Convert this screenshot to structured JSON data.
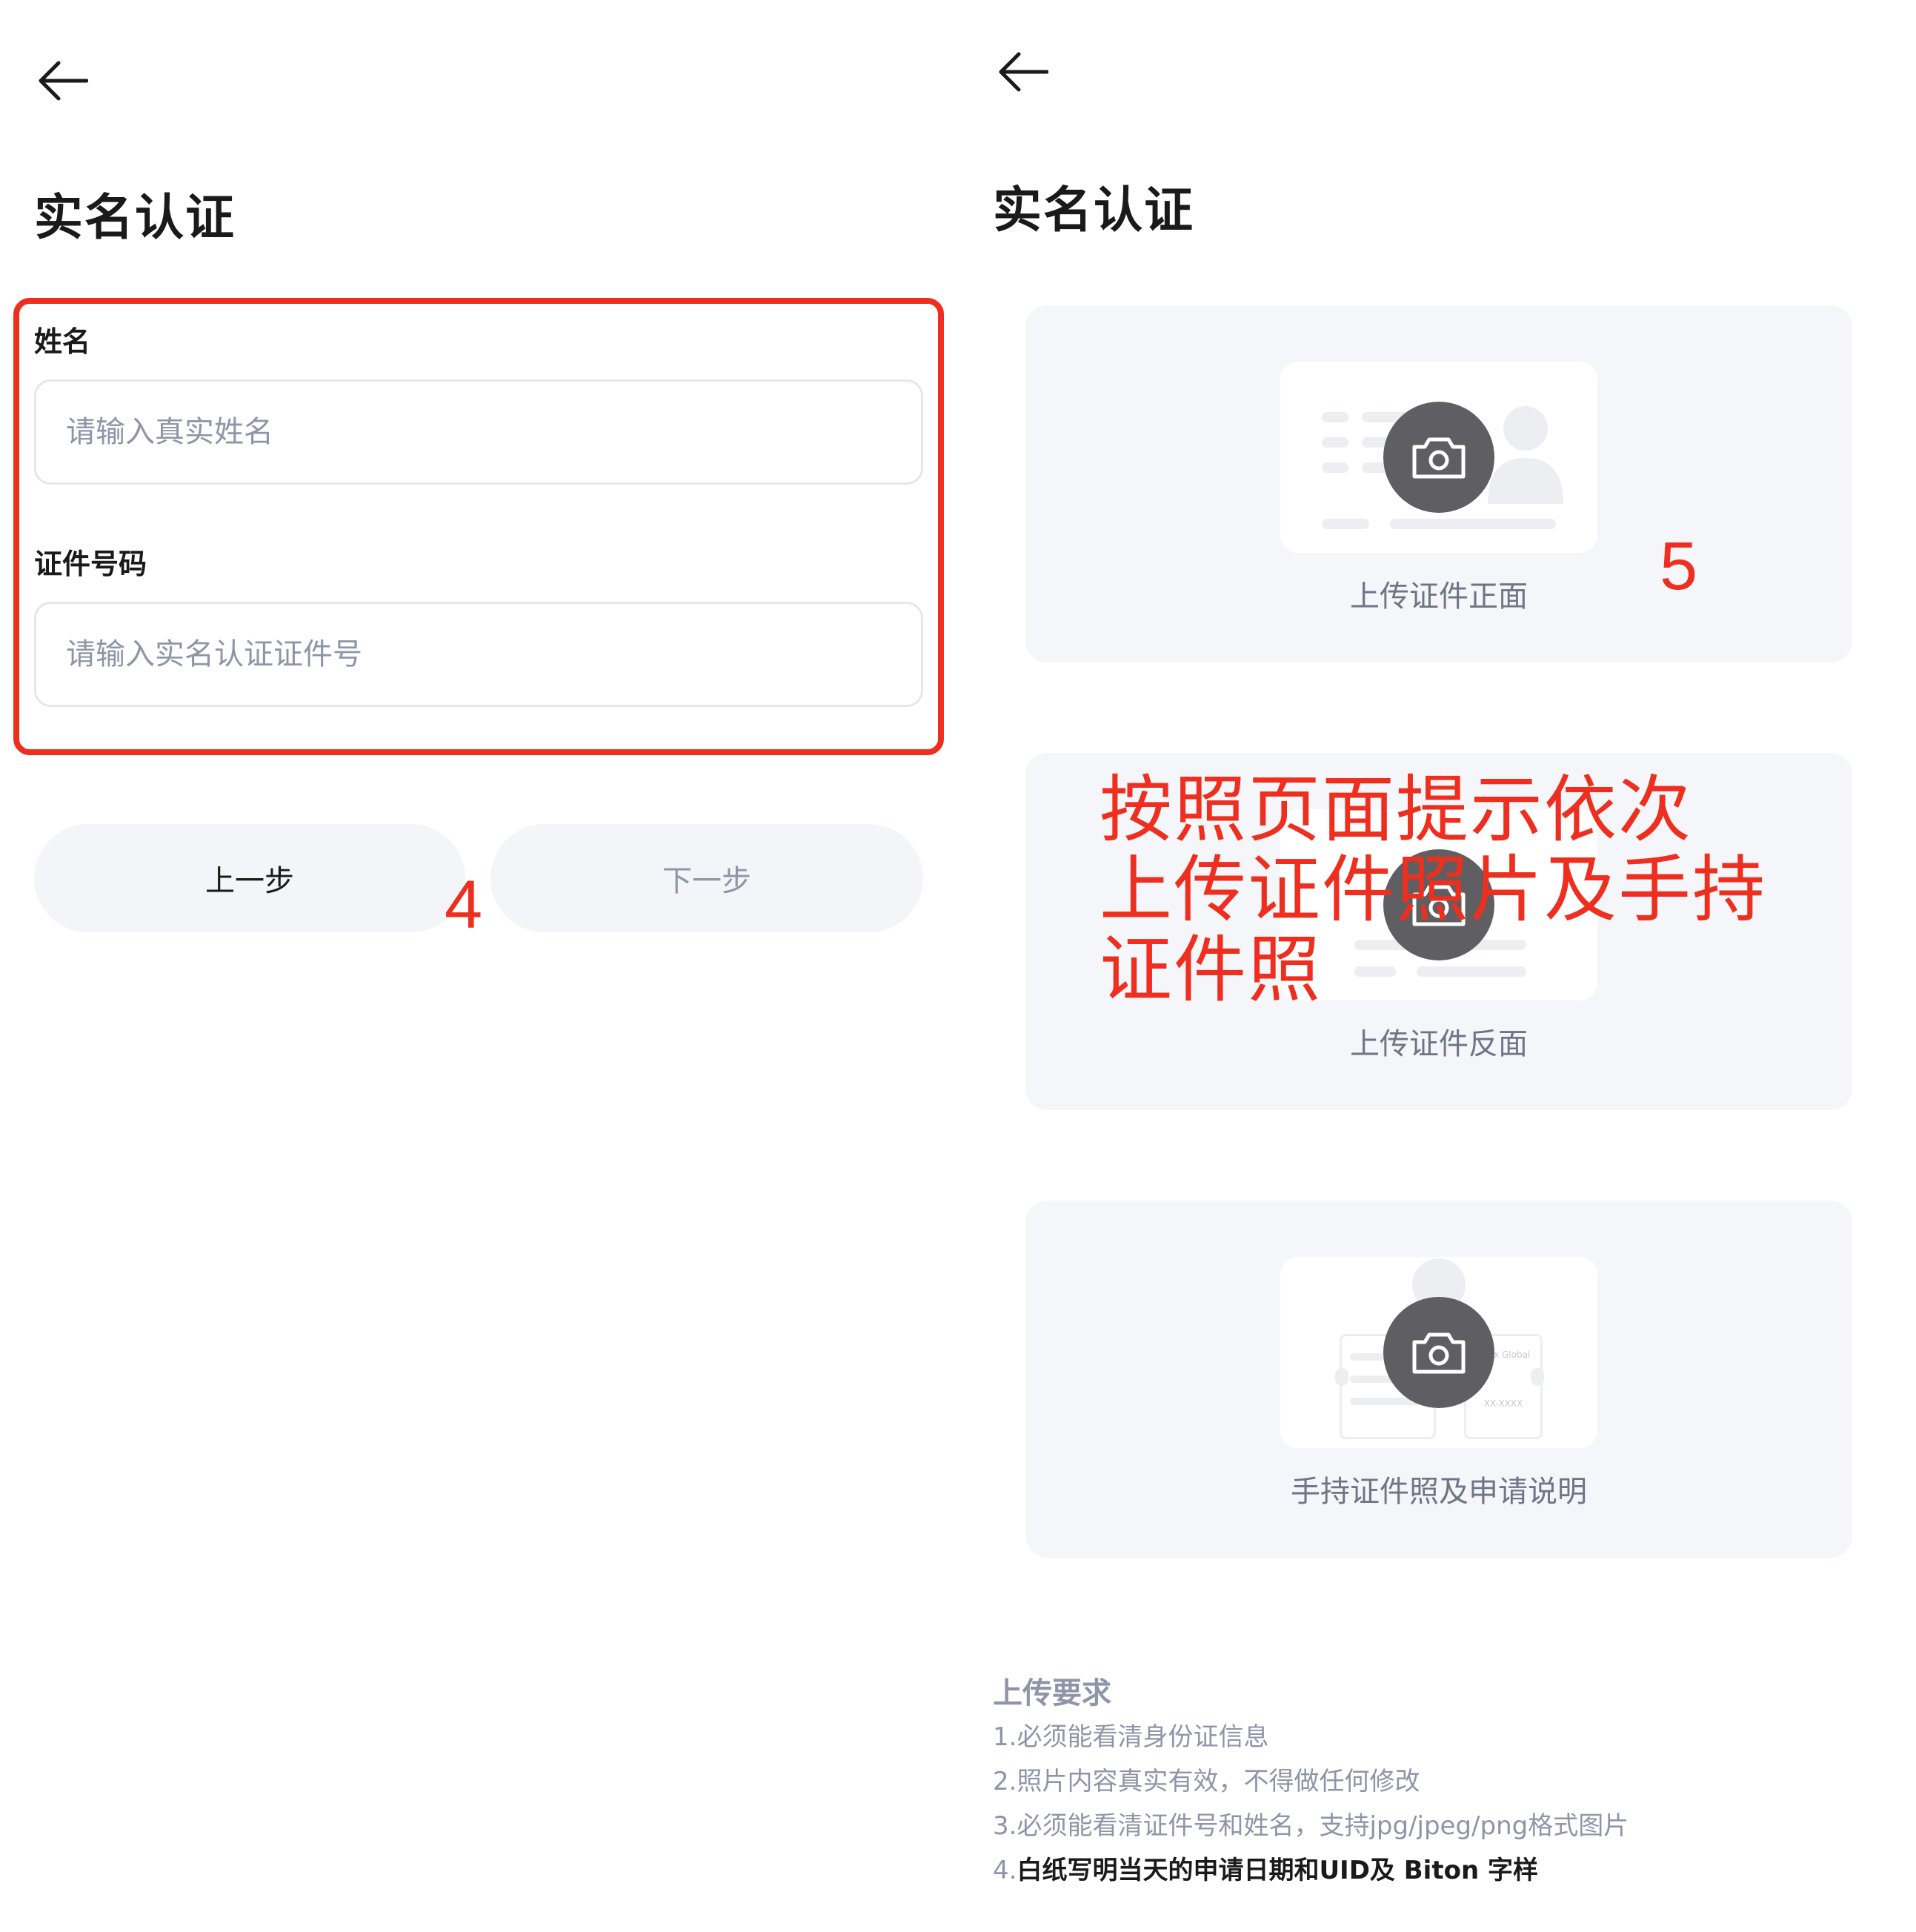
{
  "left": {
    "page_title": "实名认证",
    "form": {
      "name_label": "姓名",
      "name_placeholder": "请输入真实姓名",
      "id_label": "证件号码",
      "id_placeholder": "请输入实名认证证件号"
    },
    "buttons": {
      "prev": "上一步",
      "next": "下一步"
    },
    "annotation_step": "4"
  },
  "right": {
    "page_title": "实名认证",
    "cards": [
      {
        "label": "上传证件正面"
      },
      {
        "label": "上传证件反面"
      },
      {
        "label": "手持证件照及申请说明",
        "card_text_brand": "Bitxx Global",
        "card_text_code": "XX-XXXX"
      }
    ],
    "annotation_step": "5",
    "annotation_note_lines": [
      "按照页面提示依次",
      "上传证件照片及手持",
      "证件照"
    ],
    "requirements": {
      "title": "上传要求",
      "items": [
        {
          "num": "1.",
          "text": "必须能看清身份证信息"
        },
        {
          "num": "2.",
          "text": "照片内容真实有效，不得做任何修改"
        },
        {
          "num": "3.",
          "text": "必须能看清证件号和姓名，支持jpg/jpeg/png格式图片"
        },
        {
          "num": "4.",
          "text": "白纸写明当天的申请日期和UID及 Biton 字样"
        }
      ]
    }
  },
  "colors": {
    "annotation_red": "#ee2e1f",
    "card_bg": "#f5f6f9",
    "camera_bg": "#5f5f63",
    "muted_text": "#8f95a8"
  }
}
